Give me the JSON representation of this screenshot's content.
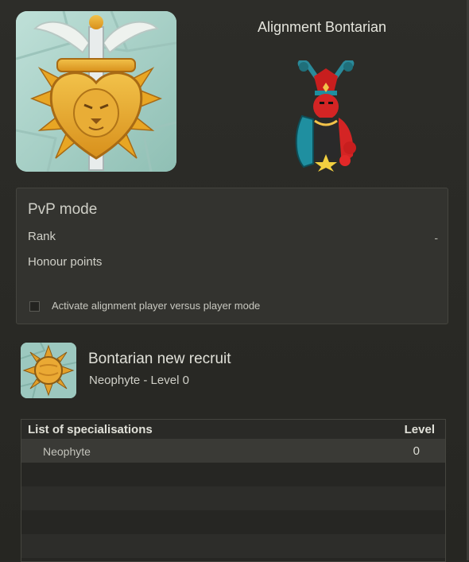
{
  "header": {
    "title": "Alignment Bontarian"
  },
  "pvp": {
    "title": "PvP mode",
    "rank_label": "Rank",
    "rank_value": "-",
    "honour_label": "Honour points",
    "toggle_label": "Activate alignment player versus player mode",
    "toggle_checked": false
  },
  "rank": {
    "name": "Bontarian new recruit",
    "subtitle": "Neophyte - Level 0"
  },
  "specialisations": {
    "col_name": "List of specialisations",
    "col_level": "Level",
    "rows": [
      {
        "name": "Neophyte",
        "level": "0"
      }
    ]
  }
}
